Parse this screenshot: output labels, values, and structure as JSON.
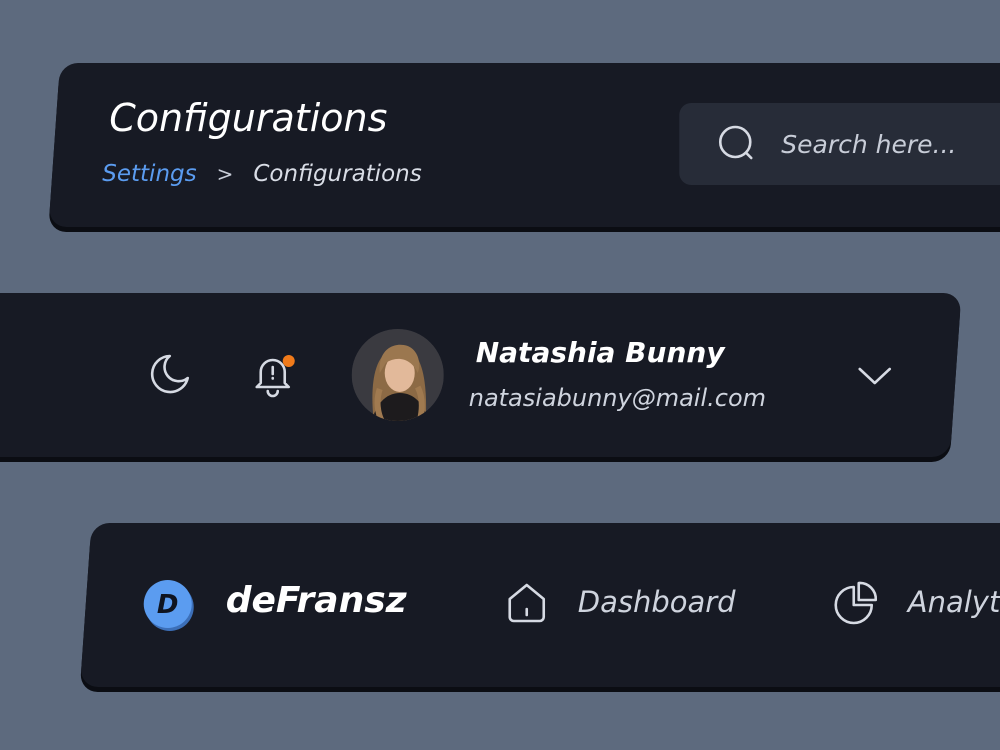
{
  "header": {
    "title": "Configurations",
    "breadcrumb": {
      "parent": "Settings",
      "separator": ">",
      "current": "Configurations"
    },
    "search": {
      "placeholder": "Search here..."
    }
  },
  "user_bar": {
    "name": "Natashia Bunny",
    "email": "natasiabunny@mail.com",
    "icons": [
      "moon-icon",
      "bell-icon",
      "chevron-down-icon"
    ],
    "notification_dot_color": "#f07a1a"
  },
  "nav": {
    "brand": {
      "initial": "D",
      "name": "deFransz",
      "logo_color": "#5b9cf0"
    },
    "items": [
      {
        "label": "Dashboard",
        "icon": "home-icon"
      },
      {
        "label": "Analyt",
        "icon": "pie-chart-icon"
      }
    ]
  },
  "colors": {
    "background": "#5d6a7e",
    "card": "#171a24",
    "accent": "#5b9cf0"
  }
}
